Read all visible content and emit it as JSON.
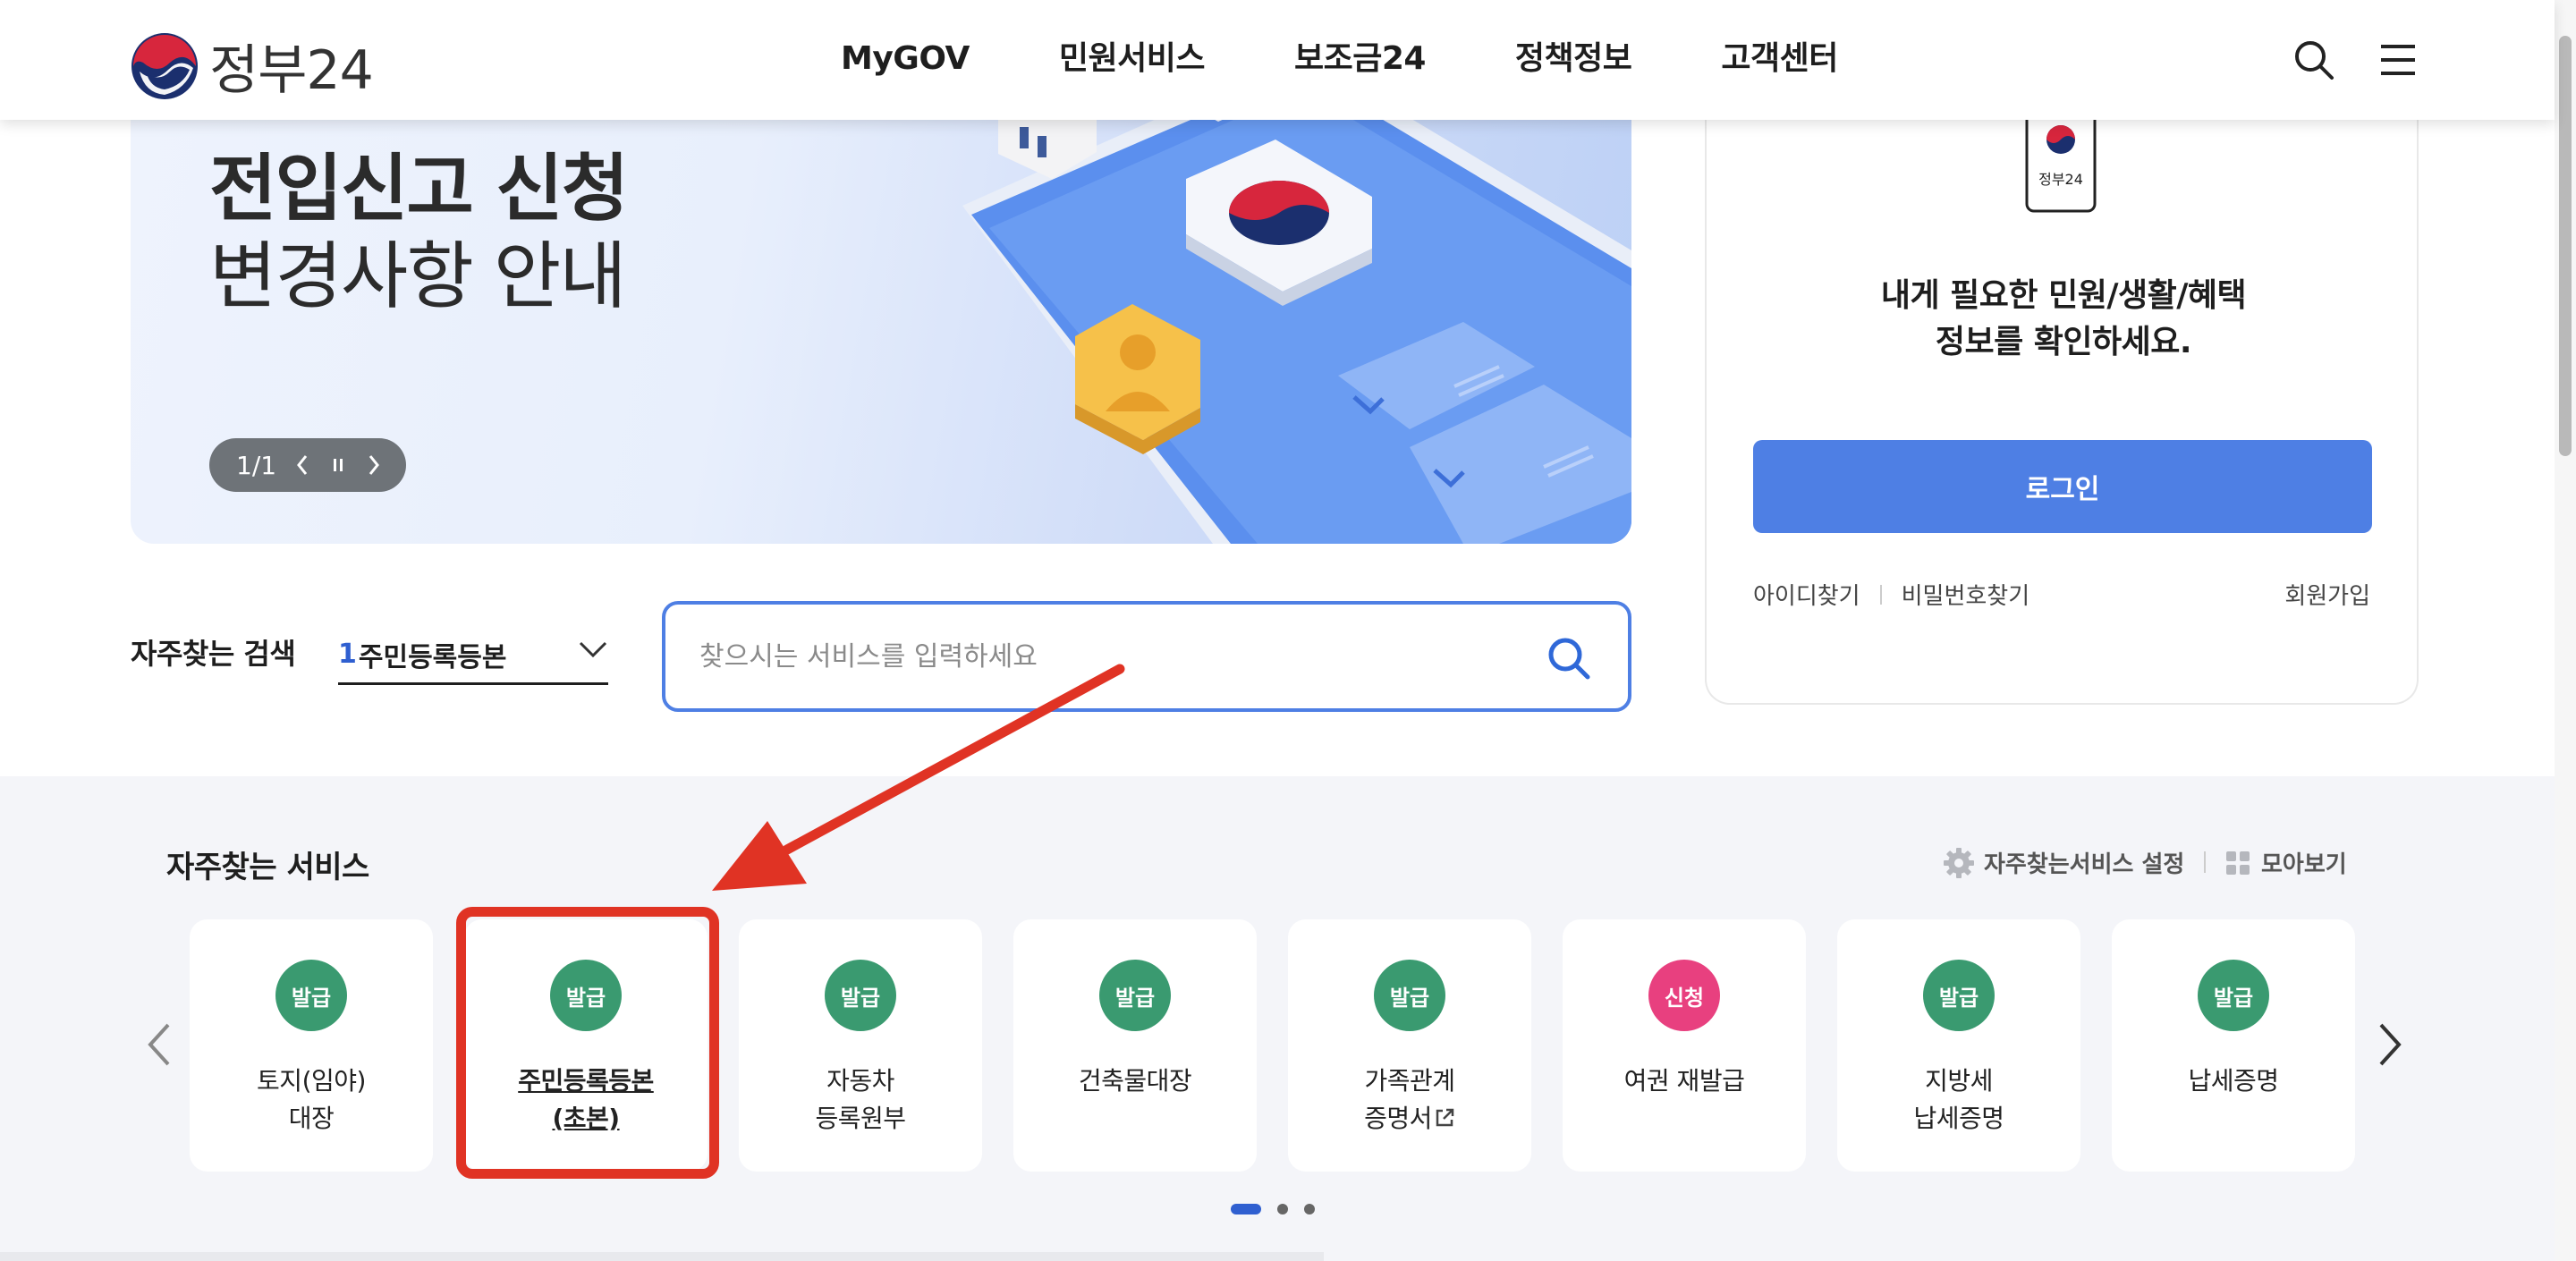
{
  "header": {
    "logo_text": "정부24",
    "nav": [
      "MyGOV",
      "민원서비스",
      "보조금24",
      "정책정보",
      "고객센터"
    ]
  },
  "banner": {
    "title": "전입신고 신청",
    "subtitle": "변경사항 안내",
    "slide_counter": "1/1"
  },
  "login": {
    "phone_label": "정부24",
    "message_line1": "내게 필요한 민원/생활/혜택",
    "message_line2": "정보를 확인하세요.",
    "login_button": "로그인",
    "find_id": "아이디찾기",
    "find_password": "비밀번호찾기",
    "join": "회원가입"
  },
  "search": {
    "frequent_label": "자주찾는 검색",
    "frequent_rank": "1",
    "frequent_term": "주민등록등본",
    "placeholder": "찾으시는 서비스를 입력하세요"
  },
  "services": {
    "title": "자주찾는 서비스",
    "settings_label": "자주찾는서비스 설정",
    "view_all_label": "모아보기",
    "cards": [
      {
        "badge": "발급",
        "label": "토지(임야)\n대장",
        "badge_color": "#3a9a70"
      },
      {
        "badge": "발급",
        "label": "주민등록등본\n(초본)",
        "badge_color": "#3a9a70",
        "selected": true
      },
      {
        "badge": "발급",
        "label": "자동차\n등록원부",
        "badge_color": "#3a9a70"
      },
      {
        "badge": "발급",
        "label": "건축물대장",
        "badge_color": "#3a9a70"
      },
      {
        "badge": "발급",
        "label": "가족관계\n증명서",
        "badge_color": "#3a9a70",
        "external_link": true
      },
      {
        "badge": "신청",
        "label": "여권 재발급",
        "badge_color": "#e8407f"
      },
      {
        "badge": "발급",
        "label": "지방세\n납세증명",
        "badge_color": "#3a9a70"
      },
      {
        "badge": "발급",
        "label": "납세증명",
        "badge_color": "#3a9a70"
      }
    ],
    "pagination_pages": 3,
    "pagination_active": 1
  },
  "colors": {
    "primary_blue": "#4e7fe4",
    "issue_green": "#3a9a70",
    "apply_pink": "#e8407f",
    "annotation_red": "#e03324"
  }
}
